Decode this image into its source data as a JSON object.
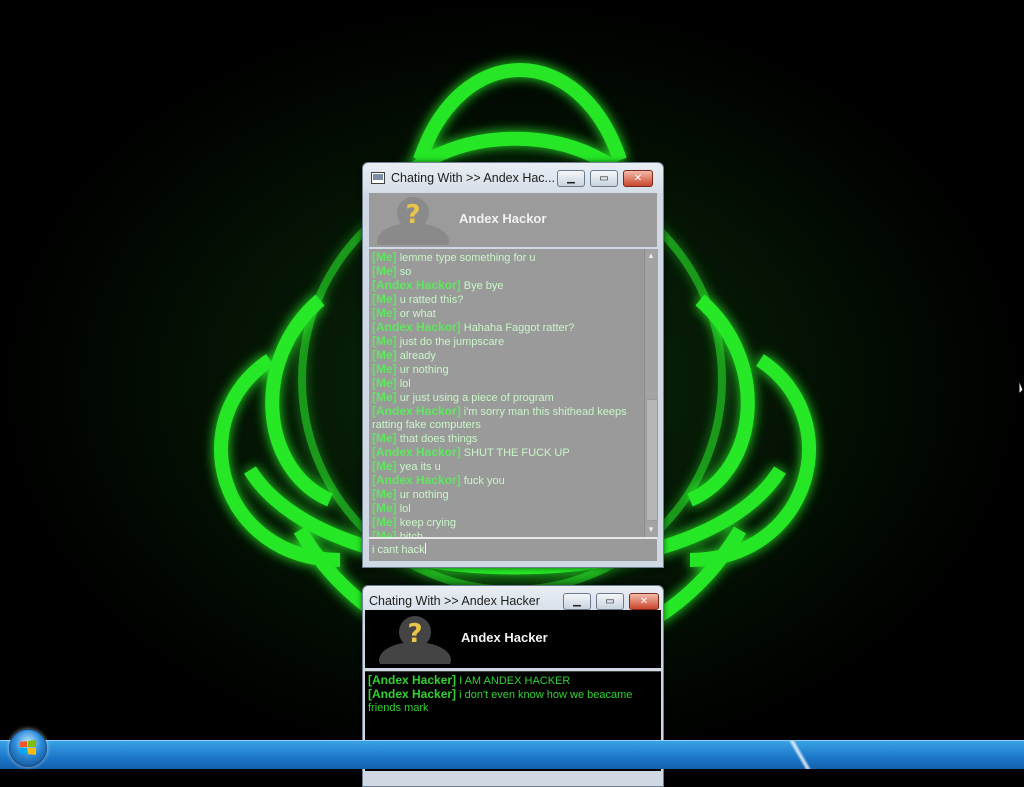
{
  "colors": {
    "wallpaper_glow": "#22ff22",
    "chat_sender": "#5ee85e",
    "chat_message": "#c8f7c8",
    "taskbar": "#1c76c9"
  },
  "window_main": {
    "title": "Chating With >> Andex Hac...",
    "minimize_icon": "minimize-icon",
    "maximize_icon": "maximize-icon",
    "close_icon": "close-icon",
    "contact_name": "Andex Hackor",
    "avatar_icon": "unknown-user-icon",
    "messages": [
      {
        "sender": "[Me]",
        "text": " lemme type something for u"
      },
      {
        "sender": "[Me]",
        "text": " so"
      },
      {
        "sender": "[Andex Hackor]",
        "text": " Bye bye"
      },
      {
        "sender": "[Me]",
        "text": " u ratted this?"
      },
      {
        "sender": "[Me]",
        "text": " or what"
      },
      {
        "sender": "[Andex Hackor]",
        "text": " Hahaha  Faggot ratter?"
      },
      {
        "sender": "[Me]",
        "text": " just do the jumpscare"
      },
      {
        "sender": "[Me]",
        "text": " already"
      },
      {
        "sender": "[Me]",
        "text": " ur nothing"
      },
      {
        "sender": "[Me]",
        "text": " lol"
      },
      {
        "sender": "[Me]",
        "text": " ur just using a piece of program"
      },
      {
        "sender": "[Andex Hackor]",
        "text": " i'm sorry man this shithead keeps ratting fake computers"
      },
      {
        "sender": "[Me]",
        "text": " that does things"
      },
      {
        "sender": "[Andex Hackor]",
        "text": " SHUT THE FUCK UP"
      },
      {
        "sender": "[Me]",
        "text": " yea its u"
      },
      {
        "sender": "[Andex Hackor]",
        "text": " fuck you"
      },
      {
        "sender": "[Me]",
        "text": " ur nothing"
      },
      {
        "sender": "[Me]",
        "text": " lol"
      },
      {
        "sender": "[Me]",
        "text": " keep crying"
      },
      {
        "sender": "[Me]",
        "text": " bitch"
      }
    ],
    "input_value": "i cant hack"
  },
  "window_second": {
    "title": "Chating With >> Andex Hacker",
    "contact_name": "Andex Hacker",
    "avatar_icon": "unknown-user-icon",
    "messages": [
      {
        "sender": "[Andex Hacker]",
        "text": " I AM ANDEX HACKER"
      },
      {
        "sender": "[Andex Hacker]",
        "text": " i don't even know how we beacame friends mark"
      }
    ]
  },
  "taskbar": {
    "start_icon": "windows-start-orb-icon"
  }
}
